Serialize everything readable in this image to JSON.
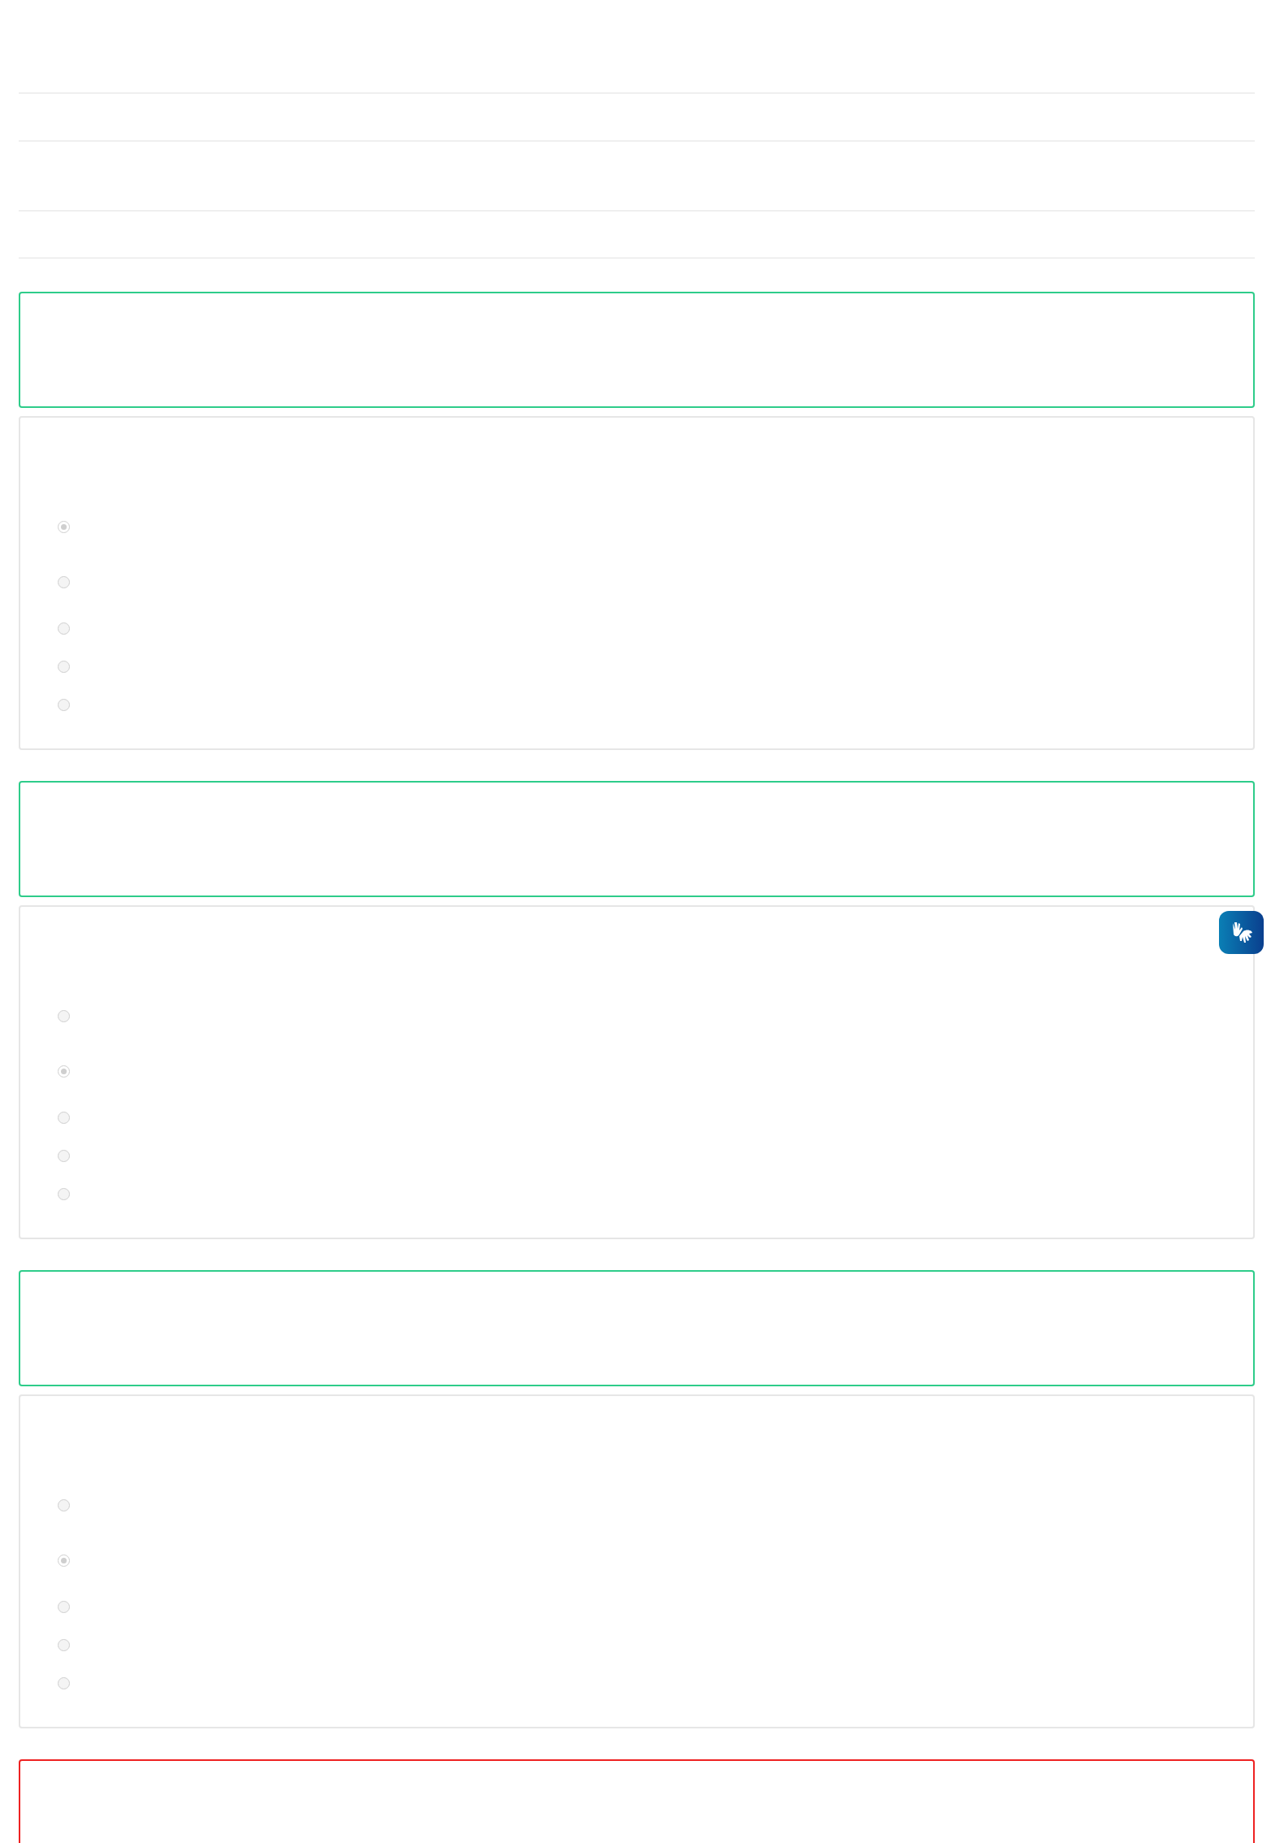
{
  "blocks": [
    {
      "kind": "correct",
      "options": [
        {
          "selected": true
        },
        {
          "selected": false
        },
        {
          "selected": false
        },
        {
          "selected": false
        },
        {
          "selected": false
        }
      ]
    },
    {
      "kind": "correct",
      "options": [
        {
          "selected": false
        },
        {
          "selected": true
        },
        {
          "selected": false
        },
        {
          "selected": false
        },
        {
          "selected": false
        }
      ]
    },
    {
      "kind": "correct",
      "options": [
        {
          "selected": false
        },
        {
          "selected": true
        },
        {
          "selected": false
        },
        {
          "selected": false
        },
        {
          "selected": false
        }
      ]
    },
    {
      "kind": "incorrect"
    }
  ]
}
